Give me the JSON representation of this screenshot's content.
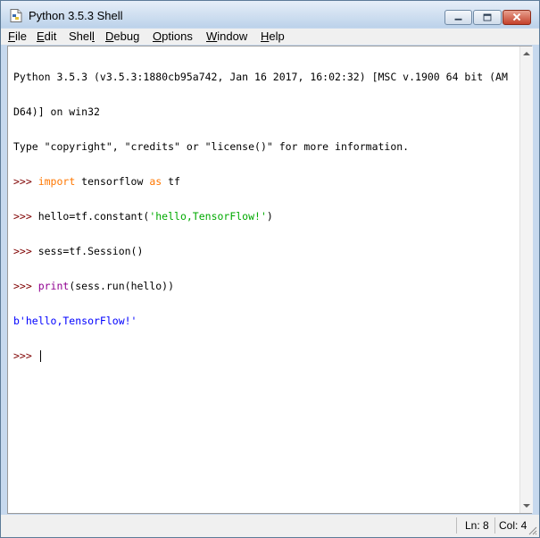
{
  "window": {
    "title": "Python 3.5.3 Shell"
  },
  "menu": {
    "items": [
      {
        "label": "File",
        "key": "F"
      },
      {
        "label": "Edit",
        "key": "E"
      },
      {
        "label": "Shell",
        "key": "l"
      },
      {
        "label": "Debug",
        "key": "D"
      },
      {
        "label": "Options",
        "key": "O"
      },
      {
        "label": "Window",
        "key": "W"
      },
      {
        "label": "Help",
        "key": "H"
      }
    ]
  },
  "shell": {
    "banner1": "Python 3.5.3 (v3.5.3:1880cb95a742, Jan 16 2017, 16:02:32) [MSC v.1900 64 bit (AM",
    "banner2": "D64)] on win32",
    "banner3": "Type \"copyright\", \"credits\" or \"license()\" for more information.",
    "prompt": ">>> ",
    "cmd1_kw1": "import",
    "cmd1_mid": " tensorflow ",
    "cmd1_kw2": "as",
    "cmd1_end": " tf",
    "cmd2_pre": "hello=tf.constant(",
    "cmd2_str": "'hello,TensorFlow!'",
    "cmd2_post": ")",
    "cmd3": "sess=tf.Session()",
    "cmd4_builtin": "print",
    "cmd4_rest": "(sess.run(hello))",
    "output": "b'hello,TensorFlow!'"
  },
  "status": {
    "ln": "Ln: 8",
    "col": "Col: 4"
  },
  "colors": {
    "prompt": "#7f0000",
    "keyword": "#ff7700",
    "string": "#00aa00",
    "builtin": "#900090",
    "output": "#0000ff"
  }
}
